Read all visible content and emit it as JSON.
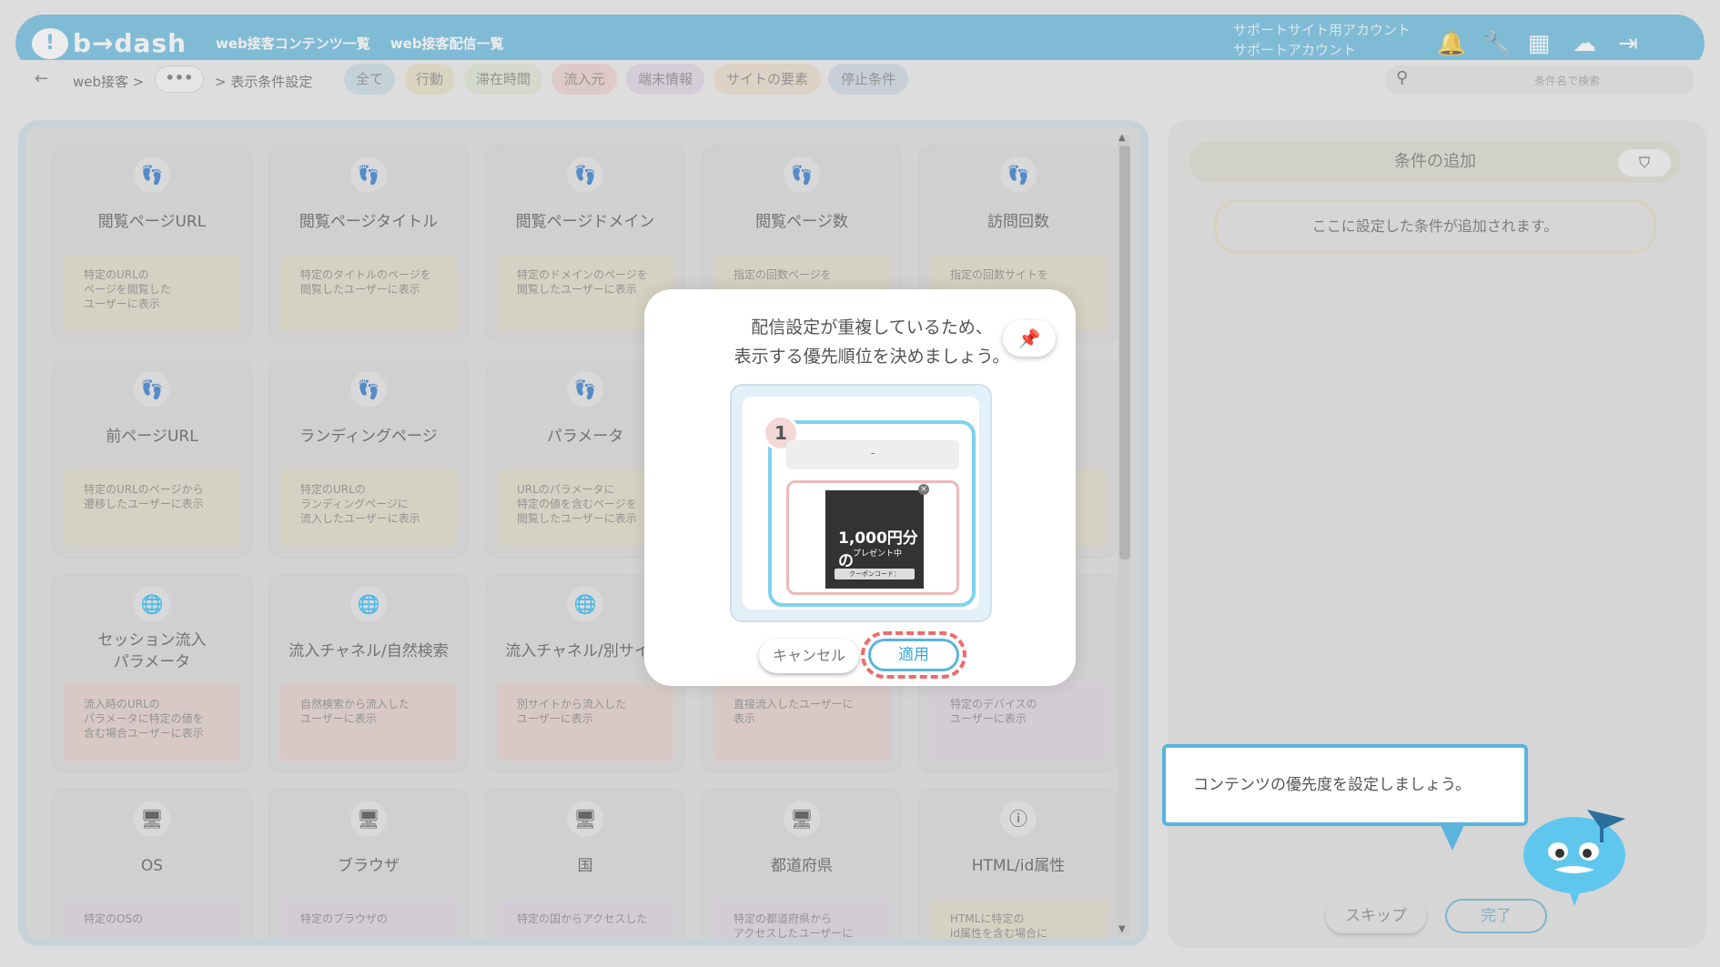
{
  "header": {
    "logo_text": "b→dash",
    "nav": [
      "web接客コンテンツ一覧",
      "web接客配信一覧"
    ],
    "account_line1": "サポートサイト用アカウント",
    "account_line2": "サポートアカウント",
    "icons": [
      "bell-icon",
      "wrench-icon",
      "grid-icon",
      "chat-icon",
      "logout-icon"
    ]
  },
  "breadcrumb": {
    "back": "←",
    "root": "web接客 >",
    "more": "•••",
    "current": "> 表示条件設定"
  },
  "filter_tabs": [
    {
      "label": "全て",
      "bg": "#c3d6e0"
    },
    {
      "label": "行動",
      "bg": "#e3dcbd"
    },
    {
      "label": "滞在時間",
      "bg": "#d9e2cc"
    },
    {
      "label": "流入元",
      "bg": "#e9c9c6"
    },
    {
      "label": "端末情報",
      "bg": "#d9cfe0"
    },
    {
      "label": "サイトの要素",
      "bg": "#e8d8c5"
    },
    {
      "label": "停止条件",
      "bg": "#c9d3e0"
    }
  ],
  "search": {
    "placeholder": "条件名で検索"
  },
  "cards": [
    {
      "icon": "footsteps-icon",
      "glyph": "👣",
      "title": "閲覧ページURL",
      "desc": "特定のURLの\nページを閲覧した\nユーザーに表示",
      "color": "#ddd8c0"
    },
    {
      "icon": "footsteps-icon",
      "glyph": "👣",
      "title": "閲覧ページタイトル",
      "desc": "特定のタイトルのページを\n閲覧したユーザーに表示",
      "color": "#ddd8c0"
    },
    {
      "icon": "footsteps-icon",
      "glyph": "👣",
      "title": "閲覧ページドメイン",
      "desc": "特定のドメインのページを\n閲覧したユーザーに表示",
      "color": "#ddd8c0"
    },
    {
      "icon": "footsteps-icon",
      "glyph": "👣",
      "title": "閲覧ページ数",
      "desc": "指定の回数ページを",
      "color": "#ddd8c0"
    },
    {
      "icon": "footsteps-icon",
      "glyph": "👣",
      "title": "訪問回数",
      "desc": "指定の回数サイトを",
      "color": "#ddd8c0"
    },
    {
      "icon": "footsteps-icon",
      "glyph": "👣",
      "title": "前ページURL",
      "desc": "特定のURLのページから\n遷移したユーザーに表示",
      "color": "#ddd8c0"
    },
    {
      "icon": "footsteps-icon",
      "glyph": "👣",
      "title": "ランディングページ",
      "desc": "特定のURLの\nランディングページに\n流入したユーザーに表示",
      "color": "#ddd8c0"
    },
    {
      "icon": "footsteps-icon",
      "glyph": "👣",
      "title": "パラメータ",
      "desc": "URLのパラメータに\n特定の値を含むページを\n閲覧したユーザーに表示",
      "color": "#ddd8c0"
    },
    {
      "icon": "footsteps-icon",
      "glyph": "👣",
      "title": "",
      "desc": "",
      "color": "#ddd8c0"
    },
    {
      "icon": "footsteps-icon",
      "glyph": "👣",
      "title": "",
      "desc": "",
      "color": "#ddd8c0"
    },
    {
      "icon": "globe-icon",
      "glyph": "🌐",
      "title": "セッション流入\nパラメータ",
      "desc": "流入時のURLの\nパラメータに特定の値を\n含む場合ユーザーに表示",
      "color": "#e0cac7"
    },
    {
      "icon": "globe-icon",
      "glyph": "🌐",
      "title": "流入チャネル/自然検索",
      "desc": "自然検索から流入した\nユーザーに表示",
      "color": "#e0cac7"
    },
    {
      "icon": "globe-icon",
      "glyph": "🌐",
      "title": "流入チャネル/別サイト",
      "desc": "別サイトから流入した\nユーザーに表示",
      "color": "#e0cac7"
    },
    {
      "icon": "globe-icon",
      "glyph": "🌐",
      "title": "",
      "desc": "直接流入したユーザーに\n表示",
      "color": "#e0cac7"
    },
    {
      "icon": "device-icon",
      "glyph": "🖥",
      "title": "",
      "desc": "特定のデバイスの\nユーザーに表示",
      "color": "#d7d0dc"
    },
    {
      "icon": "monitor-icon",
      "glyph": "🖥",
      "title": "OS",
      "desc": "特定のOSの",
      "color": "#d7d0dc"
    },
    {
      "icon": "monitor-icon",
      "glyph": "🖥",
      "title": "ブラウザ",
      "desc": "特定のブラウザの",
      "color": "#d7d0dc"
    },
    {
      "icon": "monitor-icon",
      "glyph": "🖥",
      "title": "国",
      "desc": "特定の国からアクセスした",
      "color": "#d7d0dc"
    },
    {
      "icon": "monitor-icon",
      "glyph": "🖥",
      "title": "都道府県",
      "desc": "特定の都道府県から\nアクセスしたユーザーに",
      "color": "#d7d0dc"
    },
    {
      "icon": "info-icon",
      "glyph": "ⓘ",
      "title": "HTML/id属性",
      "desc": "HTMLに特定の\nid属性を含む場合に",
      "color": "#ddd8c0"
    }
  ],
  "right_panel": {
    "add_condition": "条件の追加",
    "placeholder": "ここに設定した条件が追加されます。",
    "skip": "スキップ",
    "done": "完了"
  },
  "modal": {
    "title_line1": "配信設定が重複しているため、",
    "title_line2": "表示する優先順位を決めましょう。",
    "priority": "1",
    "content_name": "-",
    "ad_amount": "1,000円分の",
    "ad_sub": "プレゼント中",
    "ad_coupon": "クーポンコード：",
    "cancel": "キャンセル",
    "apply": "適用"
  },
  "tooltip": {
    "text": "コンテンツの優先度を設定しましょう。"
  }
}
